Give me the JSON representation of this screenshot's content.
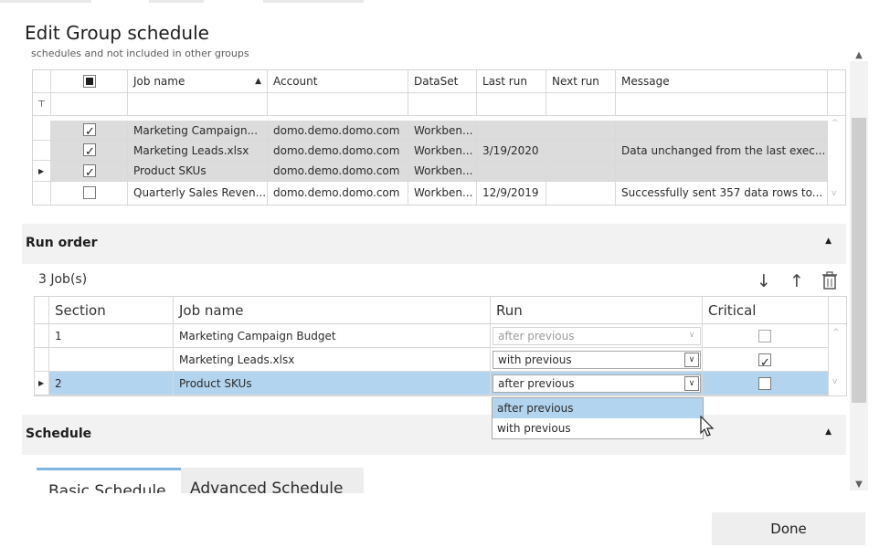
{
  "window": {
    "title": "Edit Group schedule",
    "subtitle": "schedules and not included in other groups"
  },
  "jobs_table": {
    "headers": [
      "Job name",
      "Account",
      "DataSet",
      "Last run",
      "Next run",
      "Message"
    ],
    "sort_icon": "sort-ascending-icon",
    "filter_icon": "filter-icon",
    "rows": [
      {
        "checked": true,
        "job": "Marketing Campaign...",
        "account": "domo.demo.domo.com",
        "dataset": "Workben...",
        "last_run": "",
        "next_run": "",
        "message": ""
      },
      {
        "checked": true,
        "job": "Marketing Leads.xlsx",
        "account": "domo.demo.domo.com",
        "dataset": "Workben...",
        "last_run": "3/19/2020",
        "next_run": "",
        "message": "Data unchanged from the last exec..."
      },
      {
        "checked": true,
        "job": "Product SKUs",
        "account": "domo.demo.domo.com",
        "dataset": "Workben...",
        "last_run": "",
        "next_run": "",
        "message": ""
      },
      {
        "checked": false,
        "job": "Quarterly Sales Reven...",
        "account": "domo.demo.domo.com",
        "dataset": "Workben...",
        "last_run": "12/9/2019",
        "next_run": "",
        "message": "Successfully sent 357 data rows to..."
      }
    ]
  },
  "run_order": {
    "label": "Run order",
    "job_count": "3 Job(s)",
    "headers": [
      "Section",
      "Job name",
      "Run",
      "Critical"
    ],
    "rows": [
      {
        "section": "1",
        "job": "Marketing Campaign Budget",
        "run": "after previous",
        "critical": false
      },
      {
        "section": "",
        "job": "Marketing Leads.xlsx",
        "run": "with previous",
        "critical": true
      },
      {
        "section": "2",
        "job": "Product SKUs",
        "run": "after previous",
        "critical": false
      }
    ],
    "dropdown_options": [
      "after previous",
      "with previous"
    ]
  },
  "schedule": {
    "label": "Schedule",
    "tabs": [
      "Basic Schedule",
      "Advanced Schedule"
    ]
  },
  "footer": {
    "done_label": "Done"
  },
  "colors": {
    "selected_row": "#b3d4ee",
    "highlight_option": "#b3d4ee",
    "tab_accent": "#7db4e0"
  }
}
